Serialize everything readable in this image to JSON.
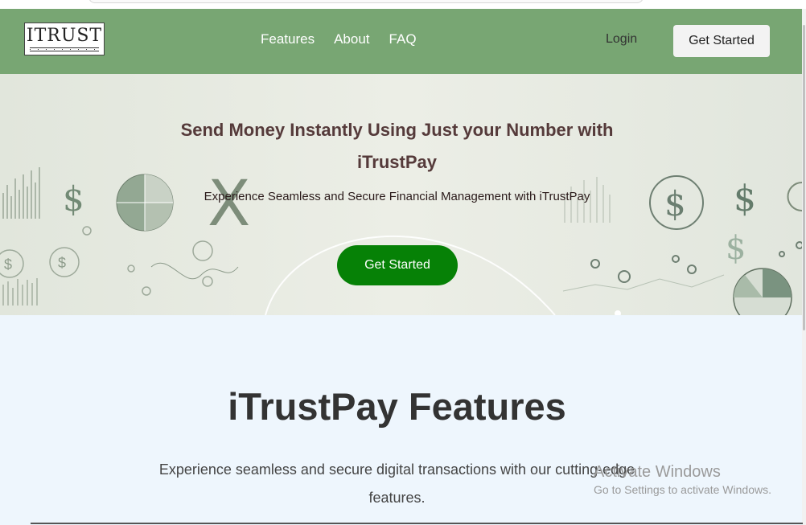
{
  "header": {
    "logo_text": "ITRUST",
    "nav": [
      {
        "label": "Features"
      },
      {
        "label": "About"
      },
      {
        "label": "FAQ"
      }
    ],
    "login_label": "Login",
    "cta_label": "Get Started"
  },
  "hero": {
    "title": "Send Money Instantly Using Just your Number with iTrustPay",
    "subtitle": "Experience Seamless and Secure Financial Management with iTrustPay",
    "cta_label": "Get Started",
    "decorations": [
      "dollar-sign-icon",
      "pie-chart-icon",
      "bar-chart-icon",
      "coin-icon"
    ]
  },
  "features": {
    "title": "iTrustPay Features",
    "description": "Experience seamless and secure digital transactions with our cutting-edge features."
  },
  "watermark": {
    "title": "Activate Windows",
    "subtitle": "Go to Settings to activate Windows."
  },
  "colors": {
    "navbar": "#78a673",
    "hero_cta": "#068106",
    "features_bg": "#eef6fd",
    "hero_title": "#553a3a"
  }
}
